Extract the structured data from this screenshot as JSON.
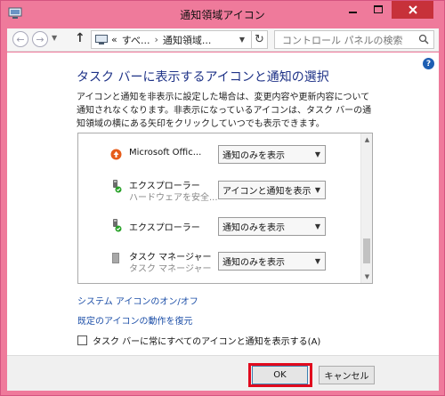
{
  "window": {
    "title": "通知領域アイコン"
  },
  "addressbar": {
    "breadcrumb": [
      "«",
      "すべ...",
      "通知領域..."
    ],
    "search_placeholder": "コントロール パネルの検索"
  },
  "content": {
    "heading": "タスク バーに表示するアイコンと通知の選択",
    "description": "アイコンと通知を非表示に設定した場合は、変更内容や更新内容について通知されなくなります。非表示になっているアイコンは、タスク バーの通知領域の横にある矢印をクリックしていつでも表示できます。",
    "icons": [
      {
        "name": "Microsoft Offic...",
        "subtitle": "",
        "behavior": "通知のみを表示",
        "icon": "office-upload-icon"
      },
      {
        "name": "エクスプローラー",
        "subtitle": "ハードウェアを安全...",
        "behavior": "アイコンと通知を表示",
        "icon": "safe-removal-icon"
      },
      {
        "name": "エクスプローラー",
        "subtitle": "",
        "behavior": "通知のみを表示",
        "icon": "safe-removal-icon"
      },
      {
        "name": "タスク マネージャー",
        "subtitle": "タスク マネージャー",
        "behavior": "通知のみを表示",
        "icon": "task-manager-icon"
      }
    ],
    "links": {
      "system_icons": "システム アイコンのオン/オフ",
      "restore_defaults": "既定のアイコンの動作を復元"
    },
    "checkbox_label": "タスク バーに常にすべてのアイコンと通知を表示する(A)",
    "help": "?"
  },
  "footer": {
    "ok": "OK",
    "cancel": "キャンセル"
  },
  "colors": {
    "frame": "#ef7a9b",
    "close": "#c7313a",
    "heading": "#1e3287",
    "link": "#1d4fa8",
    "highlight": "#e10a1e"
  }
}
